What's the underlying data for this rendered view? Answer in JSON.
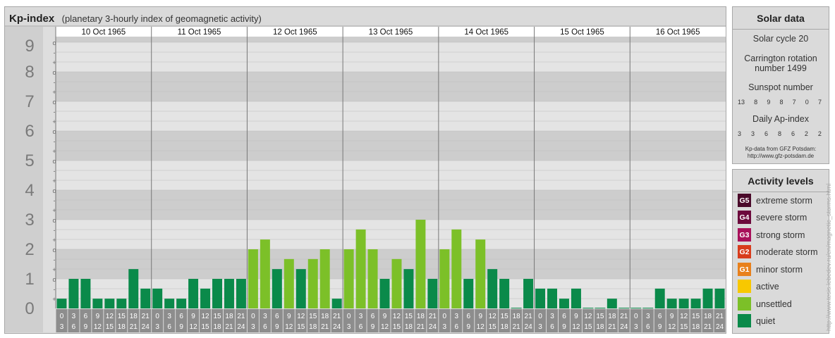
{
  "header": {
    "title": "Kp-index",
    "subtitle": "(planetary 3-hourly index of geomagnetic activity)"
  },
  "chart_data": {
    "type": "bar",
    "title": "Kp-index",
    "subtitle": "(planetary 3-hourly index of geomagnetic activity)",
    "y_major_labels": [
      "0",
      "1",
      "2",
      "3",
      "4",
      "5",
      "6",
      "7",
      "8",
      "9"
    ],
    "y_minor_labels": [
      "+",
      "o",
      "-"
    ],
    "ylim": [
      0,
      9.33
    ],
    "days": [
      "10 Oct 1965",
      "11 Oct 1965",
      "12 Oct 1965",
      "13 Oct 1965",
      "14 Oct 1965",
      "15 Oct 1965",
      "16 Oct 1965"
    ],
    "interval_start_labels": [
      "0",
      "3",
      "6",
      "9",
      "12",
      "15",
      "18",
      "21"
    ],
    "interval_end_labels": [
      "3",
      "6",
      "9",
      "12",
      "15",
      "18",
      "21",
      "24"
    ],
    "values": [
      0.33,
      1.0,
      1.0,
      0.33,
      0.33,
      0.33,
      1.33,
      0.67,
      0.67,
      0.33,
      0.33,
      1.0,
      0.67,
      1.0,
      1.0,
      1.0,
      2.0,
      2.33,
      1.33,
      1.67,
      1.33,
      1.67,
      2.0,
      0.33,
      2.0,
      2.67,
      2.0,
      1.0,
      1.67,
      1.33,
      3.0,
      1.0,
      2.0,
      2.67,
      1.0,
      2.33,
      1.33,
      1.0,
      0.0,
      1.0,
      0.67,
      0.67,
      0.33,
      0.67,
      0.0,
      0.0,
      0.33,
      0.0,
      0.0,
      0.0,
      0.67,
      0.33,
      0.33,
      0.33,
      0.67,
      0.67
    ],
    "level_colors": {
      "quiet": "#0a8a4a",
      "unsettled": "#7cc028"
    }
  },
  "solar": {
    "title": "Solar data",
    "cycle": "Solar cycle 20",
    "carrington_line1": "Carrington rotation",
    "carrington_line2": "number 1499",
    "sunspot_title": "Sunspot number",
    "sunspot_values": [
      "13",
      "8",
      "9",
      "8",
      "7",
      "0",
      "7"
    ],
    "ap_title": "Daily Ap-index",
    "ap_values": [
      "3",
      "3",
      "6",
      "8",
      "6",
      "2",
      "2"
    ],
    "credit_line1": "Kp-data from GFZ Potsdam:",
    "credit_line2": "http://www.gfz-potsdam.de"
  },
  "activity": {
    "title": "Activity levels",
    "levels": [
      {
        "badge": "G5",
        "label": "extreme storm",
        "color": "#4a0a2a"
      },
      {
        "badge": "G4",
        "label": "severe storm",
        "color": "#6c0a3c"
      },
      {
        "badge": "G3",
        "label": "strong storm",
        "color": "#a8105a"
      },
      {
        "badge": "G2",
        "label": "moderate storm",
        "color": "#d83c1c"
      },
      {
        "badge": "G1",
        "label": "minor storm",
        "color": "#e8801c"
      },
      {
        "badge": "",
        "label": "active",
        "color": "#f8c800"
      },
      {
        "badge": "",
        "label": "unsettled",
        "color": "#7cc028"
      },
      {
        "badge": "",
        "label": "quiet",
        "color": "#0a8a4a"
      }
    ]
  },
  "vertical_credit": "http://www.tesis.lebedev.ru/en/magnetic_storms.html"
}
